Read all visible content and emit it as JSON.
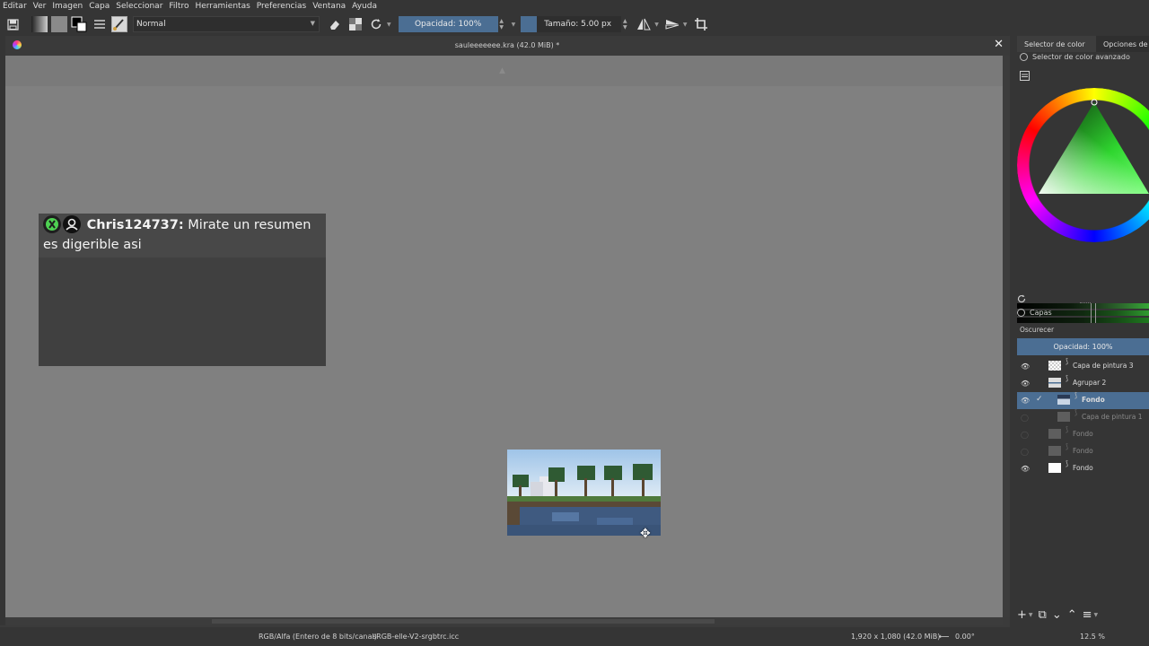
{
  "menu": [
    "Editar",
    "Ver",
    "Imagen",
    "Capa",
    "Seleccionar",
    "Filtro",
    "Herramientas",
    "Preferencias",
    "Ventana",
    "Ayuda"
  ],
  "toolbar": {
    "blend_mode": "Normal",
    "opacity_label": "Opacidad: 100%",
    "size_label": "Tamaño: 5.00 px",
    "opacity_fraction": 1.0
  },
  "document": {
    "title": "sauleeeeeee.kra (42.0 MiB) *",
    "close_glyph": "✕"
  },
  "chat": {
    "username": "Chris124737:",
    "message": "Mirate un resumen es digerible asi"
  },
  "status": {
    "color_space": "RGB/Alfa (Entero de 8 bits/canal)",
    "profile": "sRGB-elle-V2-srgbtrc.icc",
    "dimensions": "1,920 x 1,080 (42.0 MiB)",
    "rotation": "0.00°",
    "zoom": "12.5 %"
  },
  "docker": {
    "tabs": [
      "Selector de color ...",
      "Opciones de h"
    ],
    "color_panel_title": "Selector de color avanzado",
    "layers_title": "Capas",
    "layer_blend": "Oscurecer",
    "layer_opacity": "Opacidad:  100%",
    "layers": [
      {
        "name": "Capa de pintura 3",
        "visible": true,
        "selected": false,
        "dim": false
      },
      {
        "name": "Agrupar 2",
        "visible": true,
        "selected": false,
        "dim": false
      },
      {
        "name": "Fondo",
        "visible": true,
        "selected": true,
        "dim": false
      },
      {
        "name": "Capa de pintura 1",
        "visible": false,
        "selected": false,
        "dim": true
      },
      {
        "name": "Fondo",
        "visible": false,
        "selected": false,
        "dim": true
      },
      {
        "name": "Fondo",
        "visible": false,
        "selected": false,
        "dim": true
      },
      {
        "name": "Fondo",
        "visible": true,
        "selected": false,
        "dim": false
      }
    ]
  },
  "colors": {
    "accent": "#4b6e93",
    "canvas": "#808080",
    "panel": "#353535"
  }
}
